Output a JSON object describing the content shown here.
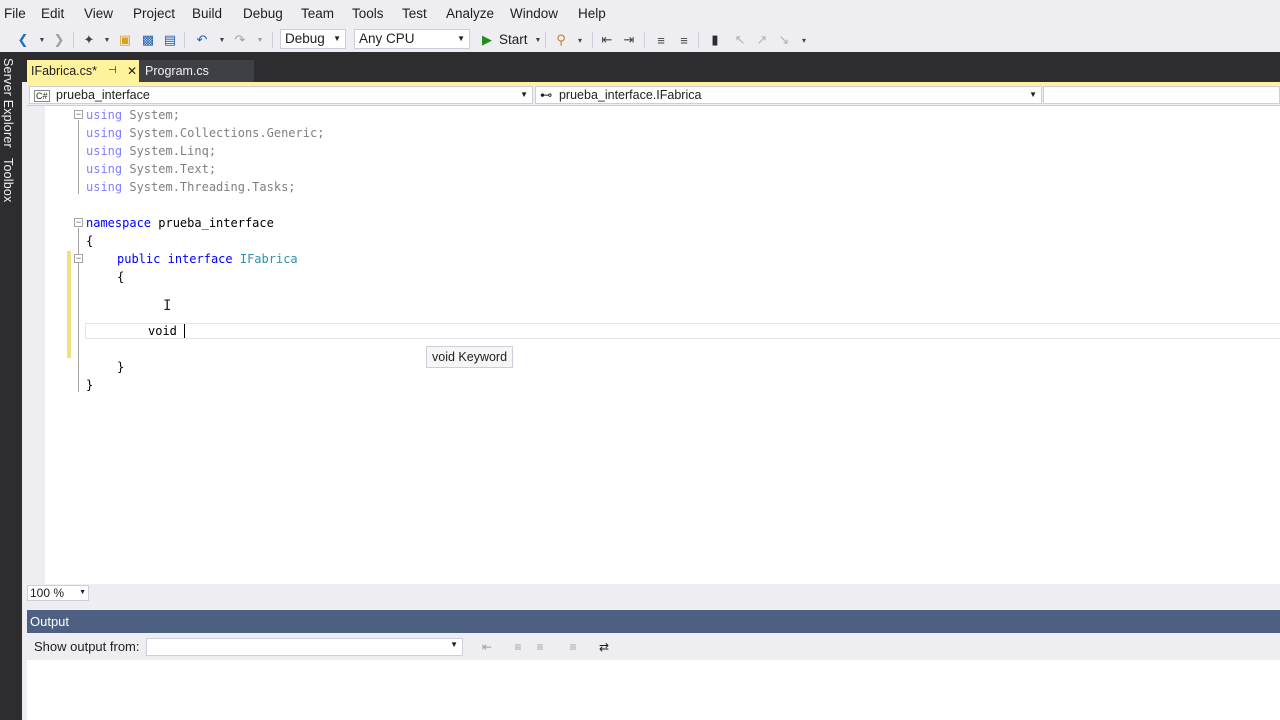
{
  "menu": [
    "File",
    "Edit",
    "View",
    "Project",
    "Build",
    "Debug",
    "Team",
    "Tools",
    "Test",
    "Analyze",
    "Window",
    "Help"
  ],
  "toolbar": {
    "config": "Debug",
    "platform": "Any CPU",
    "start_label": "Start"
  },
  "side_tabs": [
    "Server Explorer",
    "Toolbox"
  ],
  "tabs": {
    "active": "IFabrica.cs*",
    "pin": "⊣",
    "close": "✕",
    "other": "Program.cs"
  },
  "nav": {
    "project_icon": "C#",
    "project": "prueba_interface",
    "member_icon": "⊷",
    "member": "prueba_interface.IFabrica"
  },
  "code": {
    "l1_kw": "using",
    "l1_rest": " System;",
    "l2_kw": "using",
    "l2_rest": " System.Collections.Generic;",
    "l3_kw": "using",
    "l3_rest": " System.Linq;",
    "l4_kw": "using",
    "l4_rest": " System.Text;",
    "l5_kw": "using",
    "l5_rest": " System.Threading.Tasks;",
    "l7_kw": "namespace",
    "l7_rest": " prueba_interface",
    "l8": "{",
    "l9_kw1": "public",
    "l9_kw2": "interface",
    "l9_type": "IFabrica",
    "l10": "{",
    "l12": "void ",
    "l14": "}",
    "l15": "}"
  },
  "tooltip": "void Keyword",
  "zoom": "100 %",
  "output": {
    "title": "Output",
    "show_from": "Show output from:",
    "selected": ""
  },
  "colors": {
    "keyword": "#0000ff",
    "type": "#2b91af",
    "tab_active": "#fff29d",
    "output_title": "#4d6082",
    "frame_dark": "#2d2d30"
  }
}
